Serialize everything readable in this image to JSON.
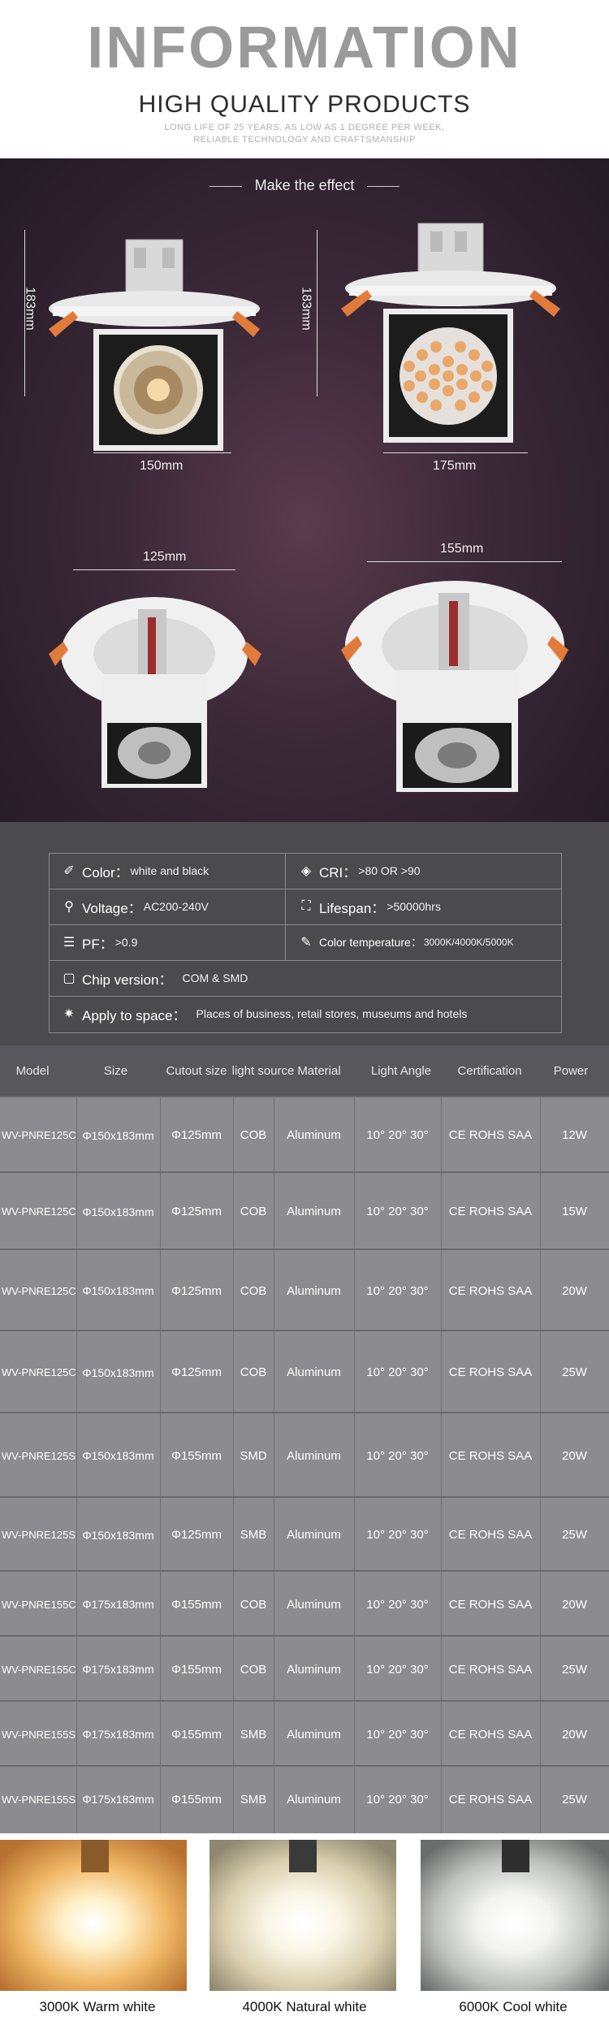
{
  "header": {
    "title": "INFORMATION",
    "subtitle": "HIGH QUALITY PRODUCTS",
    "tagline_1": "LONG LIFE OF 25 YEARS, AS LOW AS 1 DEGREE PER WEEK,",
    "tagline_2": "RELIABLE TECHNOLOGY AND CRAFTSMANSHIP"
  },
  "effect": {
    "label": "Make the effect",
    "dims": {
      "height_left": "183mm",
      "height_right": "183mm",
      "width_left": "150mm",
      "width_right": "175mm",
      "cutout_left": "125mm",
      "cutout_right": "155mm"
    }
  },
  "specs": {
    "color_label": "Color：",
    "color_value": "white and black",
    "cri_label": "CRI：",
    "cri_value": ">80 OR >90",
    "voltage_label": "Voltage：",
    "voltage_value": "AC200-240V",
    "lifespan_label": "Lifespan：",
    "lifespan_value": ">50000hrs",
    "pf_label": "PF：",
    "pf_value": ">0.9",
    "colortemp_label": "Color temperature：",
    "colortemp_value": "3000K/4000K/5000K",
    "chip_label": "Chip version：",
    "chip_value": "COM & SMD",
    "apply_label": "Apply to space：",
    "apply_value": "Places of business, retail stores, museums and hotels"
  },
  "table": {
    "headers": [
      "Model",
      "Size",
      "Cutout size",
      "light source",
      "Material",
      "Light Angle",
      "Certification",
      "Power"
    ],
    "rows": [
      [
        "WV-PNRE125C",
        "Φ150x183mm",
        "Φ125mm",
        "COB",
        "Aluminum",
        "10° 20° 30°",
        "CE ROHS SAA",
        "12W"
      ],
      [
        "WV-PNRE125C",
        "Φ150x183mm",
        "Φ125mm",
        "COB",
        "Aluminum",
        "10° 20° 30°",
        "CE ROHS SAA",
        "15W"
      ],
      [
        "WV-PNRE125C",
        "Φ150x183mm",
        "Φ125mm",
        "COB",
        "Aluminum",
        "10° 20° 30°",
        "CE ROHS SAA",
        "20W"
      ],
      [
        "WV-PNRE125C",
        "Φ150x183mm",
        "Φ125mm",
        "COB",
        "Aluminum",
        "10° 20° 30°",
        "CE ROHS SAA",
        "25W"
      ],
      [
        "WV-PNRE125S",
        "Φ150x183mm",
        "Φ155mm",
        "SMD",
        "Aluminum",
        "10° 20° 30°",
        "CE ROHS SAA",
        "20W"
      ],
      [
        "WV-PNRE125S",
        "Φ150x183mm",
        "Φ125mm",
        "SMB",
        "Aluminum",
        "10° 20° 30°",
        "CE ROHS SAA",
        "25W"
      ],
      [
        "WV-PNRE155C",
        "Φ175x183mm",
        "Φ155mm",
        "COB",
        "Aluminum",
        "10° 20° 30°",
        "CE ROHS SAA",
        "20W"
      ],
      [
        "WV-PNRE155C",
        "Φ175x183mm",
        "Φ155mm",
        "COB",
        "Aluminum",
        "10° 20° 30°",
        "CE ROHS SAA",
        "25W"
      ],
      [
        "WV-PNRE155S",
        "Φ175x183mm",
        "Φ155mm",
        "SMB",
        "Aluminum",
        "10° 20° 30°",
        "CE ROHS SAA",
        "20W"
      ],
      [
        "WV-PNRE155S",
        "Φ175x183mm",
        "Φ155mm",
        "SMB",
        "Aluminum",
        "10° 20° 30°",
        "CE ROHS SAA",
        "25W"
      ]
    ]
  },
  "swatches": [
    {
      "label": "3000K Warm white",
      "color": "#f0b866"
    },
    {
      "label": "4000K Natural white",
      "color": "#efe6c8"
    },
    {
      "label": "6000K Cool white",
      "color": "#e4e6e6"
    }
  ]
}
